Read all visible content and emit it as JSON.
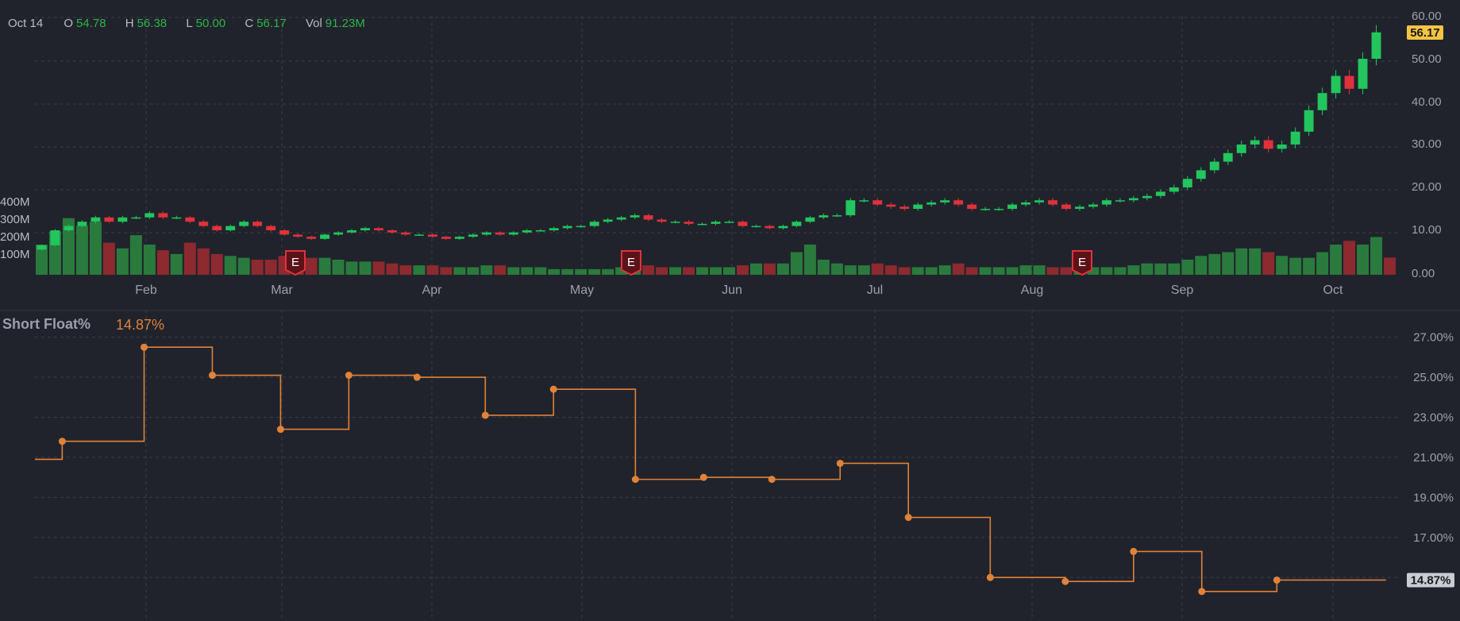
{
  "header": {
    "date": "Oct 14",
    "open_label": "O",
    "open": "54.78",
    "high_label": "H",
    "high": "56.38",
    "low_label": "L",
    "low": "50.00",
    "close_label": "C",
    "close": "56.17",
    "vol_label": "Vol",
    "vol": "91.23M"
  },
  "short_float": {
    "title": "Short Float%",
    "value": "14.87%"
  },
  "colors": {
    "background": "#20232b",
    "up": "#22c55e",
    "down": "#e0323c",
    "vol_up": "#2a7a3e",
    "vol_down": "#8c2a30",
    "accent": "#e0823a",
    "price_tag": "#f5c542",
    "grid": "#3a3e48"
  },
  "chart_data": [
    {
      "type": "candlestick",
      "x_labels": [
        "Feb",
        "Mar",
        "Apr",
        "May",
        "Jun",
        "Jul",
        "Aug",
        "Sep",
        "Oct"
      ],
      "y_ticks": [
        "60.00",
        "50.00",
        "40.00",
        "30.00",
        "20.00",
        "10.00",
        "0.00"
      ],
      "ylim": [
        0,
        60
      ],
      "last_price_tag": "56.17",
      "earnings_marker": "E",
      "earnings_months": [
        "Mar",
        "May",
        "Aug"
      ],
      "close": [
        6.5,
        10,
        11,
        12,
        13,
        12,
        13,
        13,
        14,
        13,
        13,
        12,
        11,
        10,
        11,
        12,
        11,
        10,
        9,
        8.5,
        8,
        9,
        9.5,
        10,
        10.5,
        10,
        9.5,
        9,
        9,
        8.5,
        8,
        8.5,
        9,
        9.5,
        9,
        9.5,
        10,
        10,
        10.5,
        11,
        11,
        12,
        12.5,
        13,
        13.5,
        12.5,
        12,
        12,
        11.5,
        11.5,
        12,
        12,
        11,
        11,
        10.5,
        11,
        12,
        13,
        13.5,
        13.5,
        17,
        17,
        16,
        15.5,
        15,
        16,
        16.5,
        17,
        16,
        15,
        15,
        15,
        16,
        16.5,
        17,
        16,
        15,
        15.5,
        16,
        17,
        17,
        17.5,
        18,
        19,
        20,
        22,
        24,
        26,
        28,
        30,
        31,
        29,
        30,
        33,
        38,
        42,
        46,
        43,
        50,
        56.17
      ],
      "volume_axis": [
        "400M",
        "300M",
        "200M",
        "100M"
      ],
      "volume": [
        160,
        230,
        300,
        260,
        280,
        170,
        140,
        210,
        160,
        130,
        110,
        170,
        140,
        110,
        100,
        90,
        80,
        80,
        100,
        90,
        90,
        90,
        80,
        70,
        70,
        70,
        60,
        50,
        50,
        50,
        40,
        40,
        40,
        50,
        50,
        40,
        40,
        40,
        30,
        30,
        30,
        30,
        30,
        40,
        40,
        50,
        40,
        40,
        40,
        40,
        40,
        40,
        50,
        60,
        60,
        60,
        120,
        160,
        80,
        60,
        50,
        50,
        60,
        50,
        40,
        40,
        40,
        50,
        60,
        40,
        40,
        40,
        40,
        50,
        50,
        40,
        40,
        40,
        40,
        40,
        40,
        50,
        60,
        60,
        60,
        80,
        100,
        110,
        120,
        140,
        140,
        120,
        100,
        90,
        90,
        120,
        160,
        180,
        160,
        200,
        91.23
      ]
    },
    {
      "type": "step-line",
      "name": "Short Float%",
      "y_ticks": [
        "27.00%",
        "25.00%",
        "23.00%",
        "21.00%",
        "19.00%",
        "17.00%"
      ],
      "ylim": [
        13.5,
        27.5
      ],
      "last_value_tag": "14.87%",
      "points_t": [
        0.0,
        0.02,
        0.08,
        0.13,
        0.18,
        0.23,
        0.28,
        0.33,
        0.38,
        0.44,
        0.49,
        0.54,
        0.59,
        0.64,
        0.7,
        0.755,
        0.805,
        0.855,
        0.91,
        0.99
      ],
      "points_y": [
        20.9,
        21.8,
        26.5,
        25.1,
        22.4,
        25.1,
        25.0,
        23.1,
        24.4,
        19.9,
        20.0,
        19.9,
        20.7,
        18.0,
        15.0,
        14.8,
        16.3,
        14.3,
        14.87,
        14.87
      ],
      "marker_from": 1,
      "marker_to": 18
    }
  ]
}
